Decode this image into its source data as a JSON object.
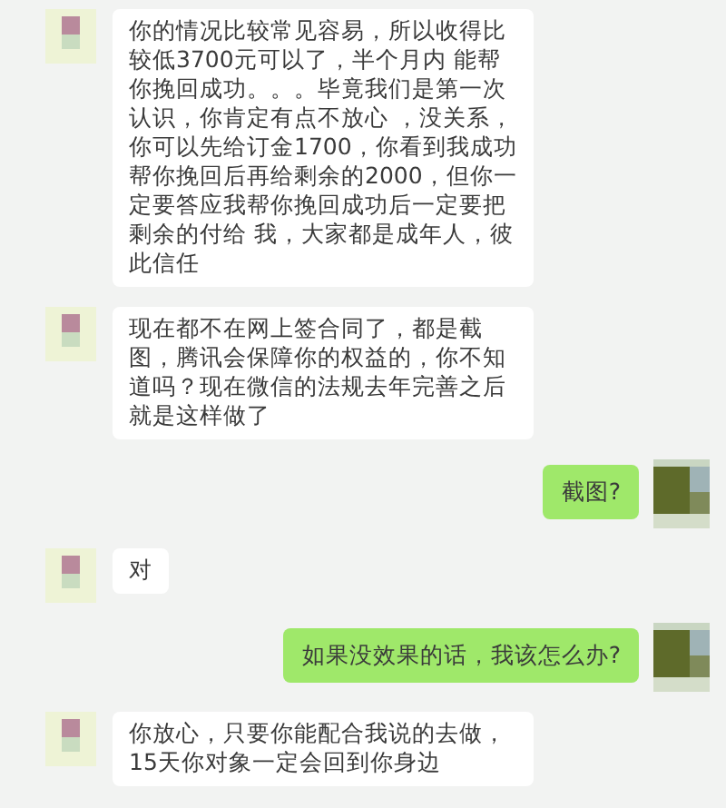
{
  "messages": [
    {
      "kind": "incoming",
      "text": "你的情况比较常见容易，所以收得比较低3700元可以了，半个月内 能帮你挽回成功。。。毕竟我们是第一次认识，你肯定有点不放心 ，没关系，你可以先给订金1700，你看到我成功帮你挽回后再给剩余的2000，但你一定要答应我帮你挽回成功后一定要把剩余的付给 我，大家都是成年人，彼此信任"
    },
    {
      "kind": "incoming",
      "text": "现在都不在网上签合同了，都是截图，腾讯会保障你的权益的，你不知道吗？现在微信的法规去年完善之后就是这样做了"
    },
    {
      "kind": "outgoing",
      "text": "截图?"
    },
    {
      "kind": "incoming",
      "text": "对"
    },
    {
      "kind": "outgoing",
      "text": "如果没效果的话，我该怎么办?"
    },
    {
      "kind": "incoming",
      "text": "你放心，只要你能配合我说的去做，15天你对象一定会回到你身边"
    }
  ]
}
